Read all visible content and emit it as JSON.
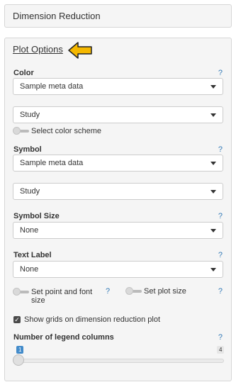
{
  "top_panel": {
    "title": "Dimension Reduction"
  },
  "plot_options": {
    "title": "Plot Options",
    "help": "?",
    "color": {
      "label": "Color",
      "select1": "Sample meta data",
      "select2": "Study",
      "toggle_label": "Select color scheme"
    },
    "symbol": {
      "label": "Symbol",
      "select1": "Sample meta data",
      "select2": "Study"
    },
    "symbol_size": {
      "label": "Symbol Size",
      "value": "None"
    },
    "text_label": {
      "label": "Text Label",
      "value": "None"
    },
    "toggles": {
      "point_font": "Set point and font size",
      "plot_size": "Set plot size"
    },
    "grid": {
      "label": "Show grids on dimension reduction plot",
      "checked": true
    },
    "legend_columns": {
      "label": "Number of legend columns",
      "min": "1",
      "max": "4",
      "value": 1
    }
  },
  "colors": {
    "accent": "#f5b800",
    "link": "#337ab7"
  }
}
